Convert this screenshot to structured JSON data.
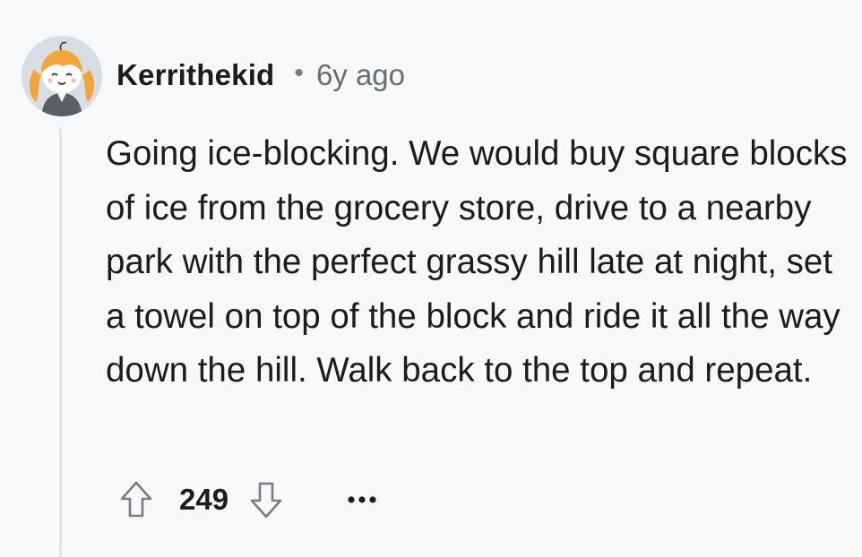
{
  "comment": {
    "author": "Kerrithekid",
    "separator": "•",
    "timestamp": "6y ago",
    "body": "Going ice-blocking. We would buy square blocks of ice from the grocery store, drive to a nearby park with the perfect grassy hill late at night, set a towel on top of the block and ride it all the way down the hill. Walk back to the top and repeat.",
    "score": "249",
    "avatar_icon": "cartoon-girl-avatar",
    "upvote_icon": "arrow-up-outline-icon",
    "downvote_icon": "arrow-down-outline-icon",
    "more_icon": "ellipsis-icon"
  },
  "colors": {
    "background": "#f7f8fa",
    "text": "#1c1c1c",
    "muted": "#6a6d70",
    "thread_line": "#e2e5e8",
    "hair": "#f3a53a"
  }
}
